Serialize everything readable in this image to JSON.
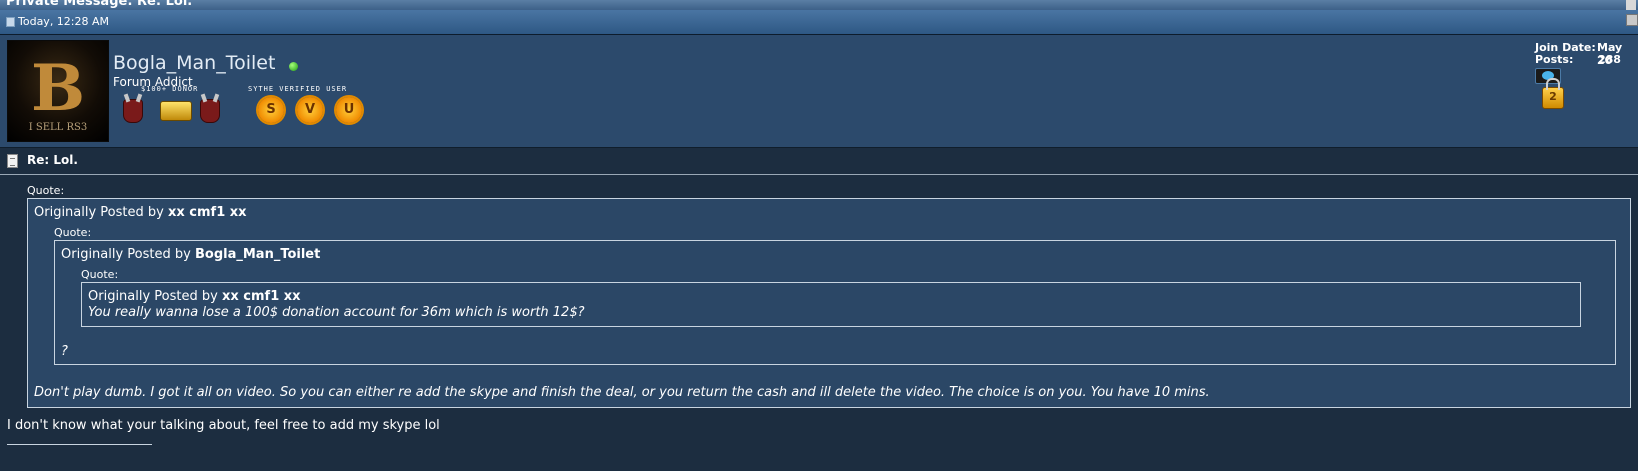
{
  "header": {
    "title": "Private Message: Re: Lol.",
    "date": "Today, 12:28 AM"
  },
  "user": {
    "avatar_letter": "B",
    "avatar_caption": "I SELL RS3",
    "name": "Bogla_Man_Toilet",
    "title": "Forum Addict",
    "badge_label_donor": "$100+ DONOR",
    "badge_label_verified": "SYTHE VERIFIED USER",
    "badge_letters": [
      "S",
      "V",
      "U"
    ],
    "join_date_label": "Join Date:",
    "join_date_value": "May 20",
    "posts_label": "Posts:",
    "posts_value": "288",
    "online_color": "#2ecc1a"
  },
  "post": {
    "title": "Re: Lol.",
    "quote_label": "Quote:",
    "originally_posted_by": "Originally Posted by",
    "quote1_author": "xx cmf1 xx",
    "quote2_author": "Bogla_Man_Toilet",
    "quote3_author": "xx cmf1 xx",
    "quote3_text": "You really wanna lose a 100$ donation account for 36m which is worth 12$?",
    "quote2_text": "?",
    "quote1_text": "Don't play dumb. I got it all on video. So you can either re add the skype and finish the deal, or you return the cash and ill delete the video. The choice is on you. You have 10 mins.",
    "reply_text": "I don't know what your talking about, feel free to add my skype lol"
  },
  "colors": {
    "header_bar": "#3d6a98",
    "user_panel": "#2c4a6c",
    "post_bg": "#1c2d40",
    "quote_bg": "#2b4766"
  }
}
